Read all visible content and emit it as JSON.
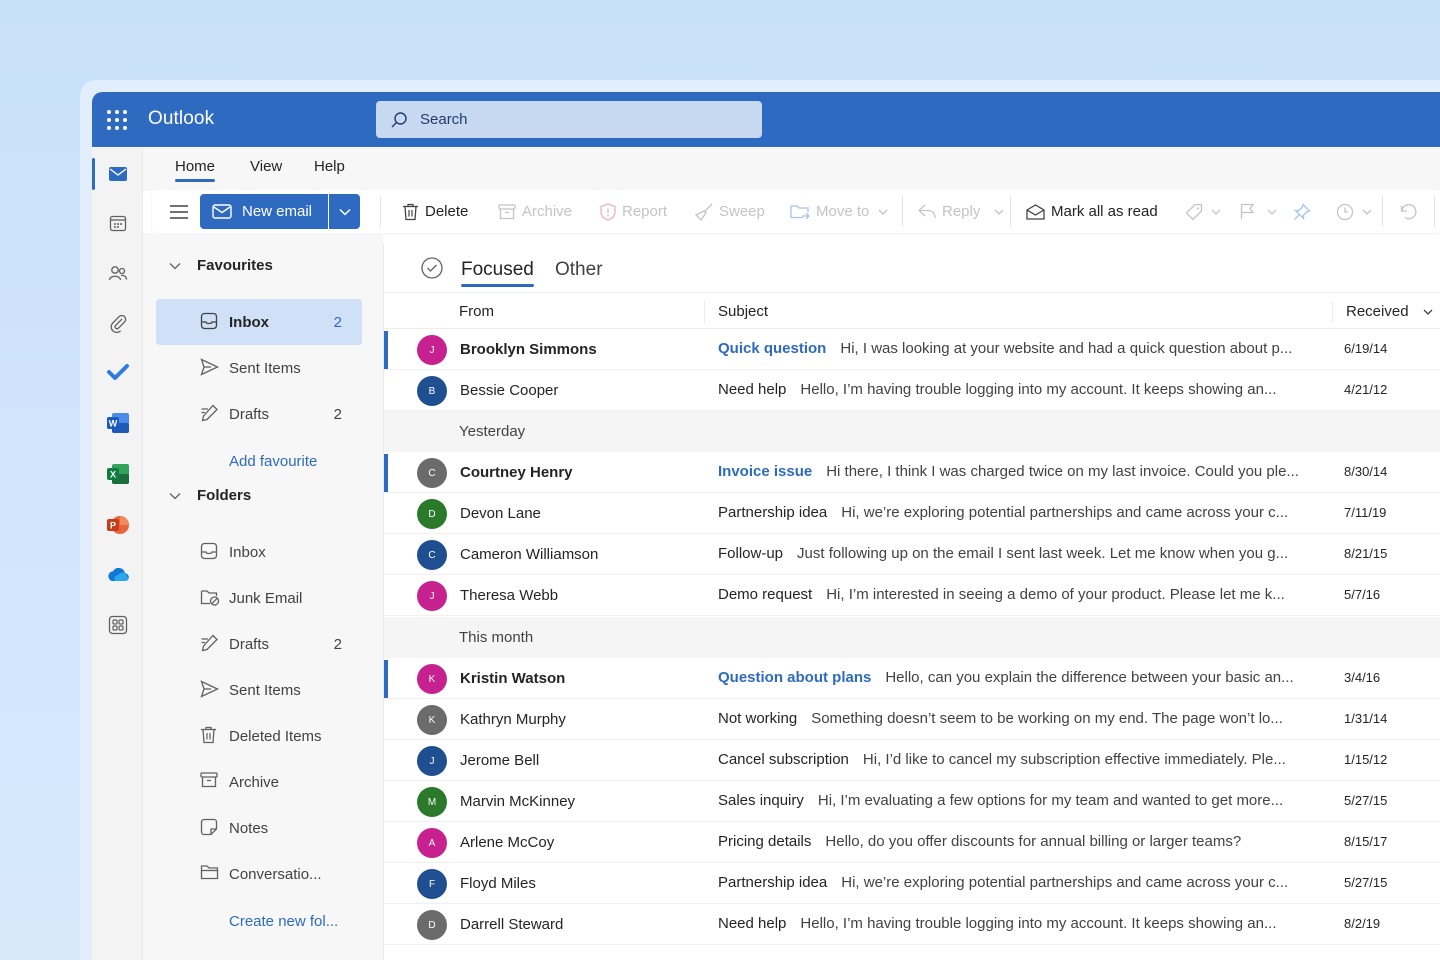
{
  "app": {
    "title": "Outlook"
  },
  "search": {
    "placeholder": "Search"
  },
  "ribbon": {
    "tabs": [
      "Home",
      "View",
      "Help"
    ],
    "new_email": "New email",
    "delete": "Delete",
    "archive": "Archive",
    "report": "Report",
    "sweep": "Sweep",
    "move_to": "Move to",
    "reply": "Reply",
    "mark_all_read": "Mark all as read"
  },
  "folders": {
    "favourites_label": "Favourites",
    "favourites": [
      {
        "label": "Inbox",
        "count": "2"
      },
      {
        "label": "Sent Items",
        "count": ""
      },
      {
        "label": "Drafts",
        "count": "2"
      }
    ],
    "add_favourite": "Add favourite",
    "folders_label": "Folders",
    "items": [
      {
        "label": "Inbox",
        "count": ""
      },
      {
        "label": "Junk Email",
        "count": ""
      },
      {
        "label": "Drafts",
        "count": "2"
      },
      {
        "label": "Sent Items",
        "count": ""
      },
      {
        "label": "Deleted Items",
        "count": ""
      },
      {
        "label": "Archive",
        "count": ""
      },
      {
        "label": "Notes",
        "count": ""
      },
      {
        "label": "Conversatio...",
        "count": ""
      }
    ],
    "create_new": "Create new fol..."
  },
  "list": {
    "pivot": [
      "Focused",
      "Other"
    ],
    "columns": {
      "from": "From",
      "subject": "Subject",
      "received": "Received"
    },
    "groups": [
      "Yesterday",
      "This month"
    ],
    "messages": [
      {
        "initial": "J",
        "color": "#c7208f",
        "from": "Brooklyn Simmons",
        "subject": "Quick question",
        "preview": "Hi, I was looking at your website and had a quick question about p...",
        "date": "6/19/14",
        "unread": true
      },
      {
        "initial": "B",
        "color": "#1f4e91",
        "from": "Bessie Cooper",
        "subject": "Need help",
        "preview": "Hello, I’m having trouble logging into my account. It keeps showing an...",
        "date": "4/21/12",
        "unread": false
      },
      {
        "initial": "C",
        "color": "#6b6b6b",
        "from": "Courtney Henry",
        "subject": "Invoice issue",
        "preview": "Hi there, I think I was charged twice on my last invoice. Could you ple...",
        "date": "8/30/14",
        "unread": true
      },
      {
        "initial": "D",
        "color": "#2b7a2b",
        "from": "Devon Lane",
        "subject": "Partnership idea",
        "preview": "Hi, we’re exploring potential partnerships and came across your c...",
        "date": "7/11/19",
        "unread": false
      },
      {
        "initial": "C",
        "color": "#1f4e91",
        "from": "Cameron Williamson",
        "subject": "Follow-up",
        "preview": "Just following up on the email I sent last week. Let me know when you g...",
        "date": "8/21/15",
        "unread": false
      },
      {
        "initial": "J",
        "color": "#c7208f",
        "from": "Theresa Webb",
        "subject": "Demo request",
        "preview": "Hi, I’m interested in seeing a demo of your product. Please let me k...",
        "date": "5/7/16",
        "unread": false
      },
      {
        "initial": "K",
        "color": "#c7208f",
        "from": "Kristin Watson",
        "subject": "Question about plans",
        "preview": "Hello, can you explain the difference between your basic an...",
        "date": "3/4/16",
        "unread": true
      },
      {
        "initial": "K",
        "color": "#6b6b6b",
        "from": "Kathryn Murphy",
        "subject": "Not working",
        "preview": "Something doesn’t seem to be working on my end. The page won’t lo...",
        "date": "1/31/14",
        "unread": false
      },
      {
        "initial": "J",
        "color": "#1f4e91",
        "from": "Jerome Bell",
        "subject": "Cancel subscription",
        "preview": "Hi, I’d like to cancel my subscription effective immediately. Ple...",
        "date": "1/15/12",
        "unread": false
      },
      {
        "initial": "M",
        "color": "#2b7a2b",
        "from": "Marvin McKinney",
        "subject": "Sales inquiry",
        "preview": "Hi, I’m evaluating a few options for my team and wanted to get more...",
        "date": "5/27/15",
        "unread": false
      },
      {
        "initial": "A",
        "color": "#c7208f",
        "from": "Arlene McCoy",
        "subject": "Pricing details",
        "preview": "Hello, do you offer discounts for annual billing or larger teams?",
        "date": "8/15/17",
        "unread": false
      },
      {
        "initial": "F",
        "color": "#1f4e91",
        "from": "Floyd Miles",
        "subject": "Partnership idea",
        "preview": "Hi, we’re exploring potential partnerships and came across your c...",
        "date": "5/27/15",
        "unread": false
      },
      {
        "initial": "D",
        "color": "#6b6b6b",
        "from": "Darrell Steward",
        "subject": "Need help",
        "preview": "Hello, I’m having trouble logging into my account. It keeps showing an...",
        "date": "8/2/19",
        "unread": false
      }
    ]
  },
  "colors": {
    "brand": "#2e6bc0",
    "selected": "#cfe0f7"
  }
}
